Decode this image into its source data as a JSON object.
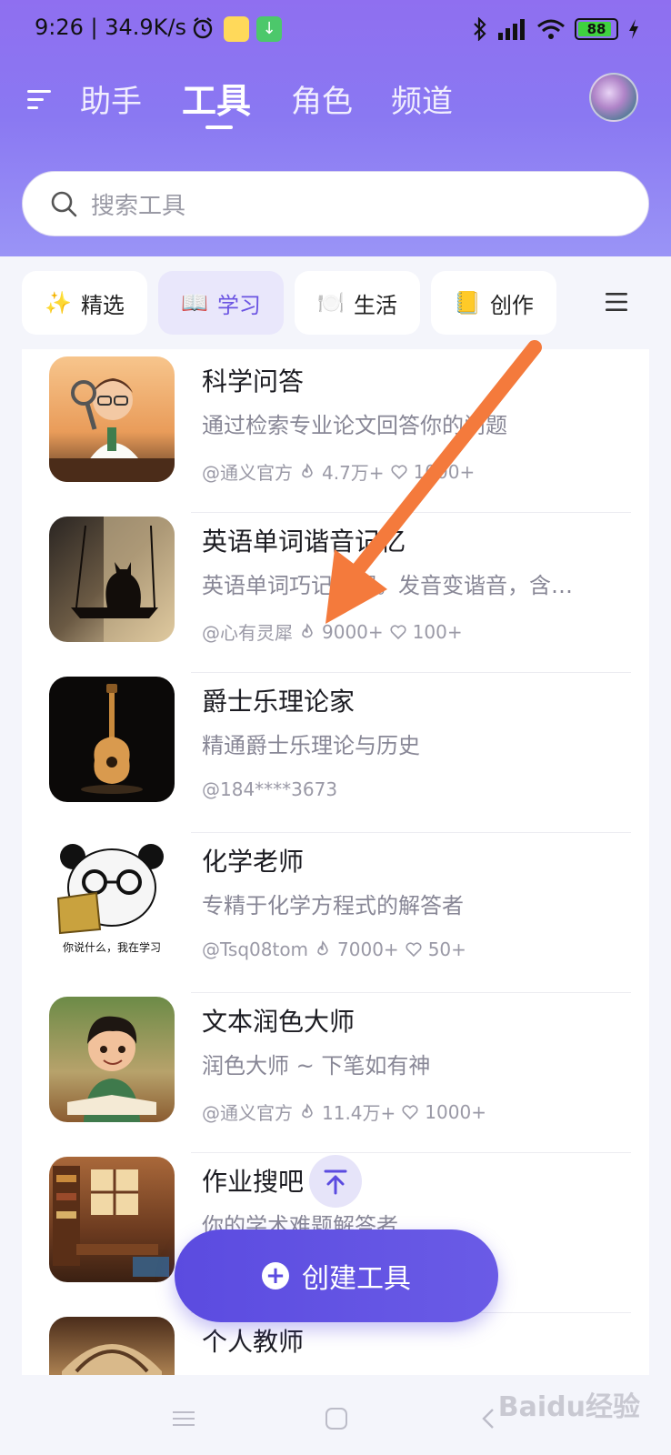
{
  "status_bar": {
    "time": "9:26 | 34.9K/s",
    "battery": "88"
  },
  "nav": {
    "tabs": [
      {
        "label": "助手"
      },
      {
        "label": "工具"
      },
      {
        "label": "角色"
      },
      {
        "label": "频道"
      }
    ],
    "active_index": 1
  },
  "search": {
    "placeholder": "搜索工具"
  },
  "categories": [
    {
      "emoji": "✨",
      "label": "精选"
    },
    {
      "emoji": "📖",
      "label": "学习"
    },
    {
      "emoji": "🍽️",
      "label": "生活"
    },
    {
      "emoji": "📒",
      "label": "创作"
    }
  ],
  "tools": [
    {
      "title": "科学问答",
      "desc": "通过检索专业论文回答你的问题",
      "author": "@通义官方",
      "hot": "4.7万+",
      "likes": "1000+"
    },
    {
      "title": "英语单词谐音记忆",
      "desc": "英语单词巧记妙解。发音变谐音，含…",
      "author": "@心有灵犀",
      "hot": "9000+",
      "likes": "100+"
    },
    {
      "title": "爵士乐理论家",
      "desc": "精通爵士乐理论与历史",
      "author": "@184****3673",
      "hot": "",
      "likes": ""
    },
    {
      "title": "化学老师",
      "desc": "专精于化学方程式的解答者",
      "author": "@Tsq08tom",
      "hot": "7000+",
      "likes": "50+"
    },
    {
      "title": "文本润色大师",
      "desc": "润色大师 ~ 下笔如有神",
      "author": "@通义官方",
      "hot": "11.4万+",
      "likes": "1000+"
    },
    {
      "title": "作业搜吧",
      "desc": "你的学术难题解答者",
      "author": "",
      "hot": "",
      "likes": ""
    },
    {
      "title": "个人教师",
      "desc": "",
      "author": "",
      "hot": "",
      "likes": ""
    }
  ],
  "thumb_captions": {
    "panda": "你说什么，我在学习"
  },
  "create_button": {
    "label": "创建工具"
  },
  "watermark": "Baidu经验",
  "colors": {
    "accent": "#5b4be0",
    "header_top": "#8f6ff0",
    "annotation_arrow": "#f47a3c"
  }
}
